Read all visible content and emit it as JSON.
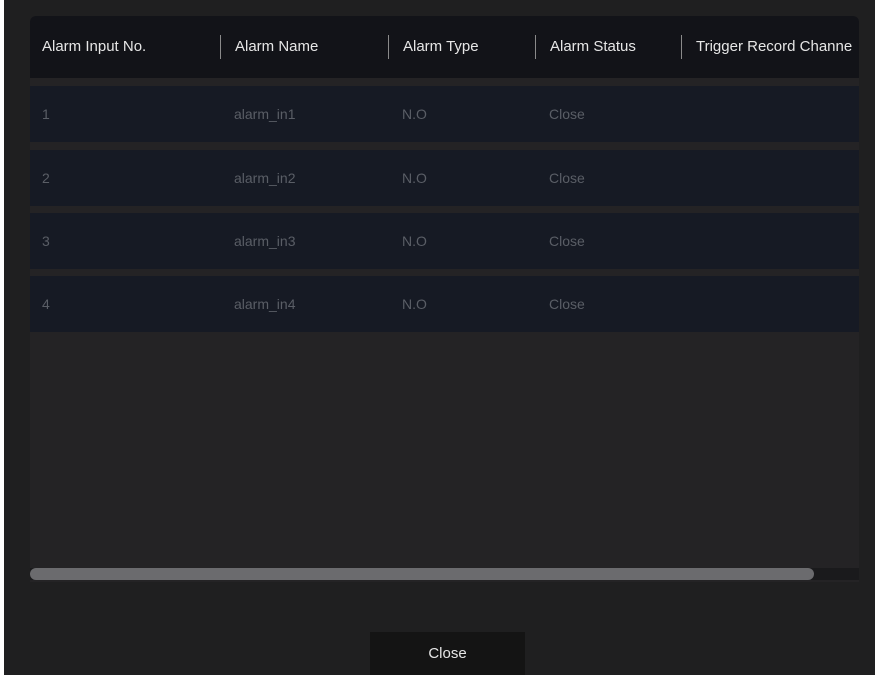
{
  "table": {
    "columns": [
      "Alarm Input No.",
      "Alarm Name",
      "Alarm Type",
      "Alarm Status",
      "Trigger Record Channe"
    ],
    "rows": [
      {
        "no": "1",
        "name": "alarm_in1",
        "type": "N.O",
        "status": "Close",
        "trigger": ""
      },
      {
        "no": "2",
        "name": "alarm_in2",
        "type": "N.O",
        "status": "Close",
        "trigger": ""
      },
      {
        "no": "3",
        "name": "alarm_in3",
        "type": "N.O",
        "status": "Close",
        "trigger": ""
      },
      {
        "no": "4",
        "name": "alarm_in4",
        "type": "N.O",
        "status": "Close",
        "trigger": ""
      }
    ]
  },
  "scrollbar": {
    "position_fraction": 0.0,
    "visible_fraction": 0.95
  },
  "footer": {
    "close_label": "Close"
  }
}
